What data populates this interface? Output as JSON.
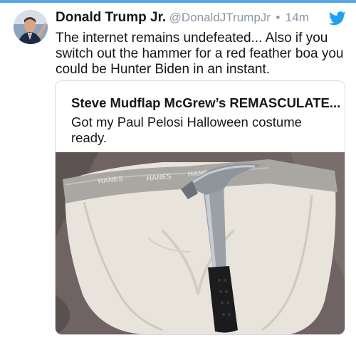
{
  "tweet": {
    "display_name": "Donald Trump Jr.",
    "handle": "@DonaldJTrumpJr",
    "separator": "•",
    "time": "14m",
    "text": "The internet remains undefeated... Also if you switch out the hammer for a red feather boa you could be Hunter Biden in an instant."
  },
  "quote": {
    "author": "Steve Mudflap McGrew’s REMASCULATE...",
    "text": "Got my Paul Pelosi Halloween costume ready.",
    "photo": {
      "brand_text": "HANES"
    }
  },
  "colors": {
    "accent": "#1da1f2",
    "top_bar": "#5aa7e6",
    "name_text": "#14171a",
    "muted_text": "#8b96a0",
    "card_border": "#d4dbe1"
  },
  "icons": {
    "logo": "twitter-bird-icon"
  }
}
